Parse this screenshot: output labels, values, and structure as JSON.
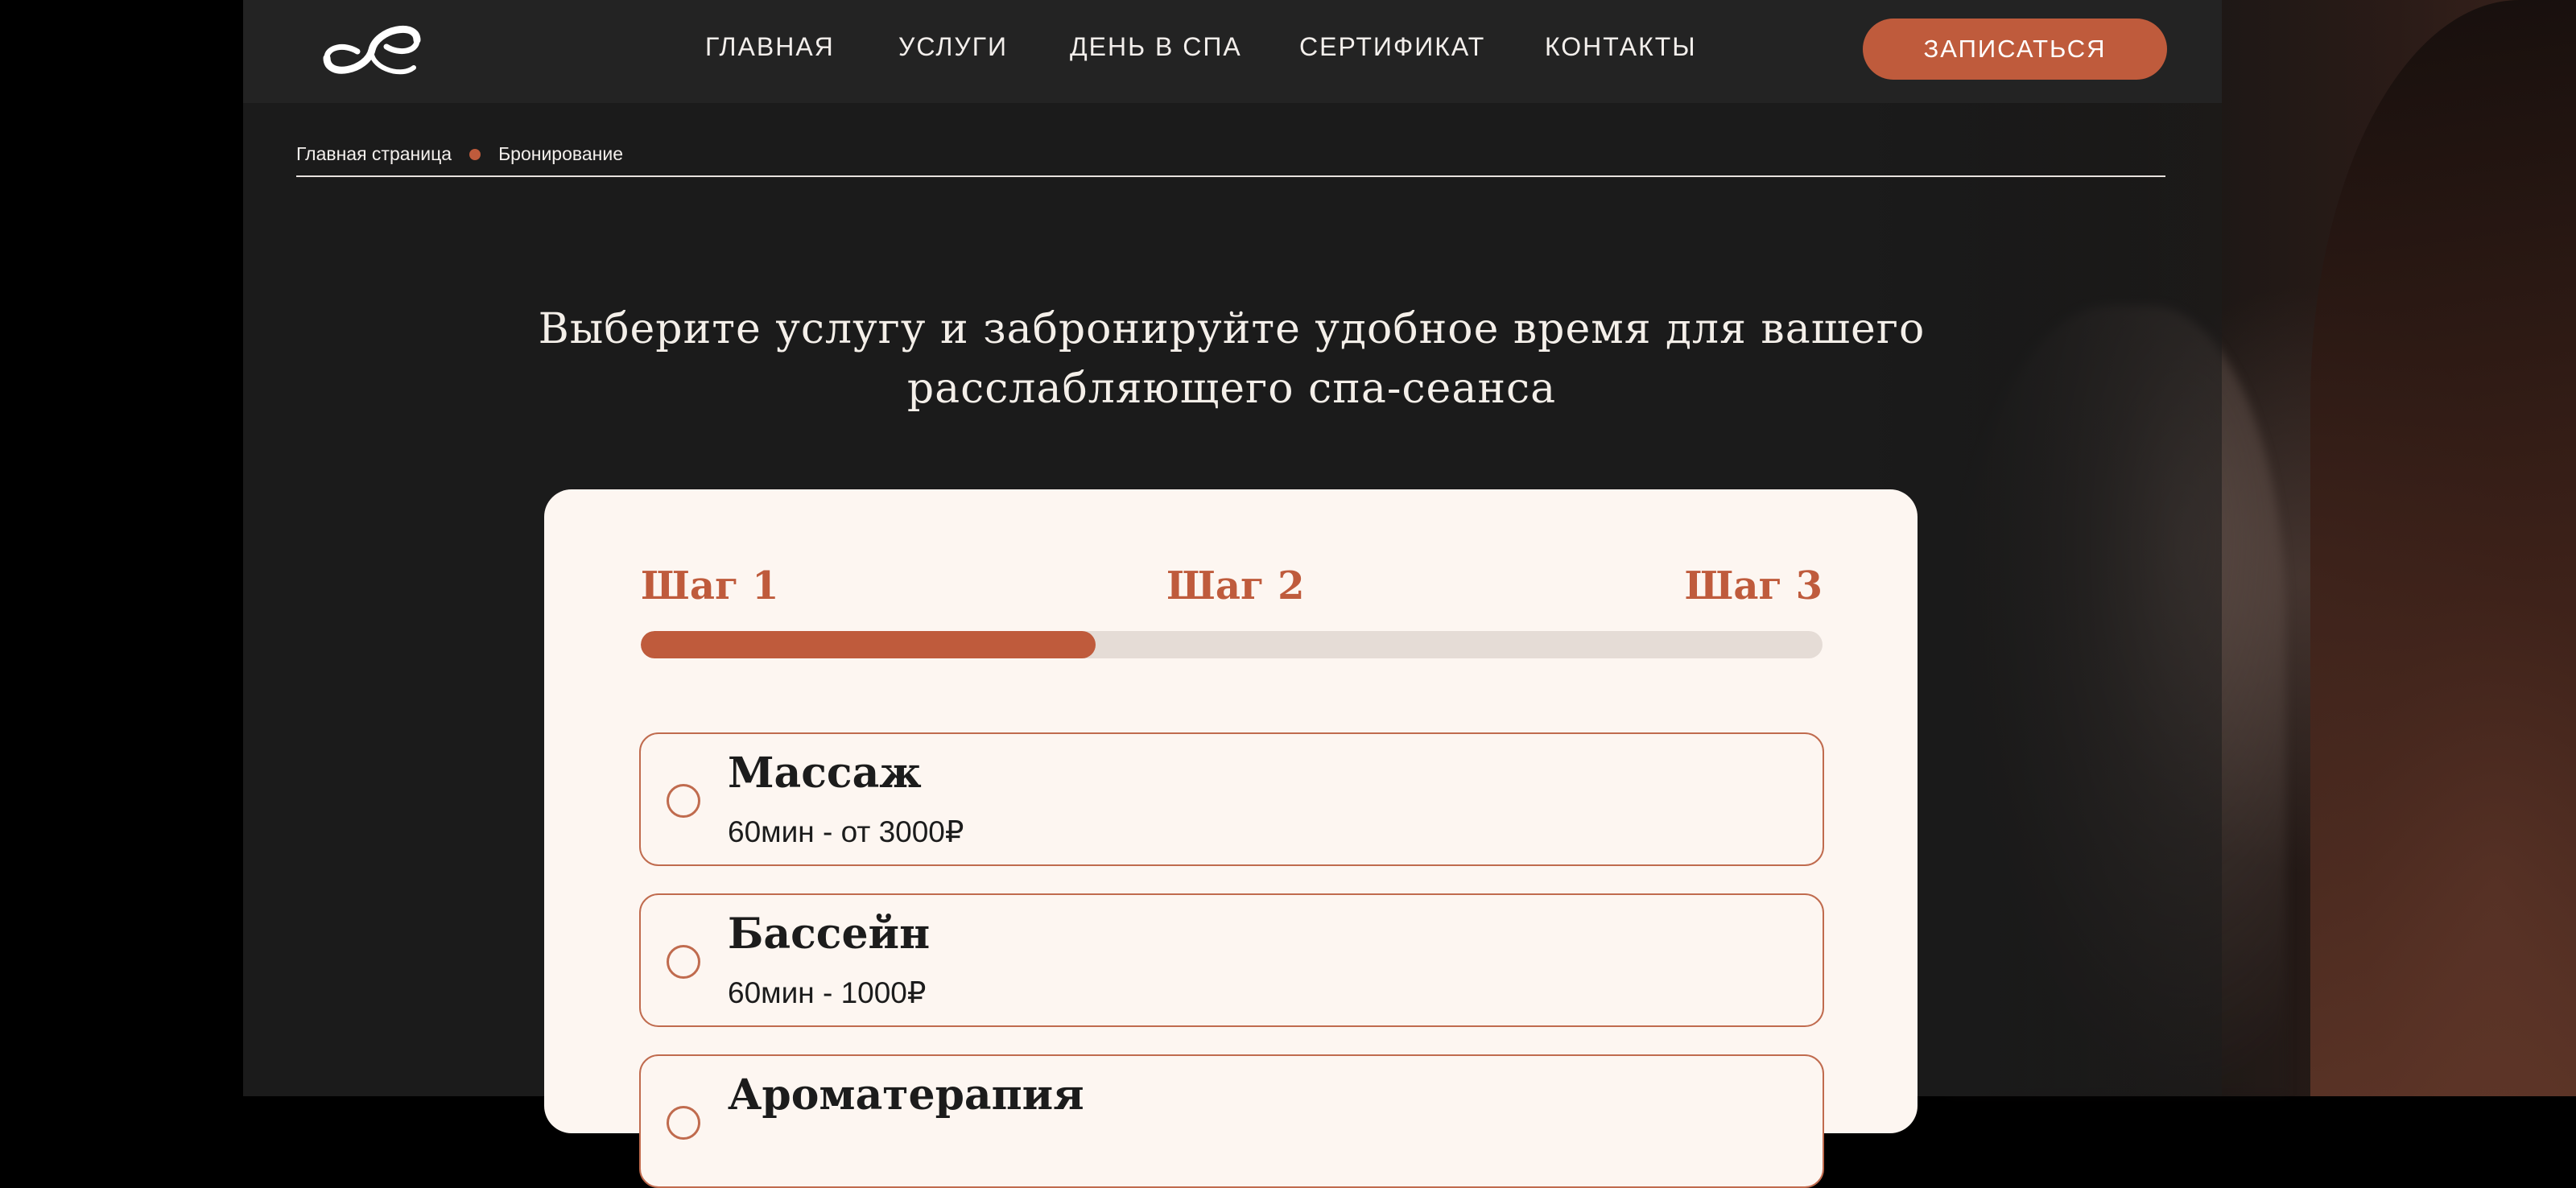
{
  "header": {
    "nav": [
      {
        "label": "ГЛАВНАЯ"
      },
      {
        "label": "УСЛУГИ"
      },
      {
        "label": "ДЕНЬ В СПА"
      },
      {
        "label": "СЕРТИФИКАТ"
      },
      {
        "label": "КОНТАКТЫ"
      }
    ],
    "cta_label": "ЗАПИСАТЬСЯ"
  },
  "breadcrumb": {
    "home": "Главная страница",
    "current": "Бронирование"
  },
  "title": "Выберите услугу и забронируйте удобное время для вашего расслабляющего спа-сеанса",
  "booking": {
    "steps": [
      "Шаг 1",
      "Шаг 2",
      "Шаг 3"
    ],
    "progress_fraction": 0.385,
    "options": [
      {
        "title": "Массаж",
        "subtitle": "60мин - от 3000₽",
        "selected": false
      },
      {
        "title": "Бассейн",
        "subtitle": "60мин - 1000₽",
        "selected": false
      },
      {
        "title": "Ароматерапия",
        "subtitle": "",
        "selected": false
      }
    ]
  },
  "colors": {
    "accent": "#bf5b3c",
    "panel": "#1b1b1b",
    "header": "#232323",
    "card": "#fdf6f1",
    "track": "#e5dcd6"
  },
  "icons": {
    "logo": "infinity-logo-icon",
    "breadcrumb_separator": "dot-icon",
    "option_marker": "radio-icon"
  }
}
